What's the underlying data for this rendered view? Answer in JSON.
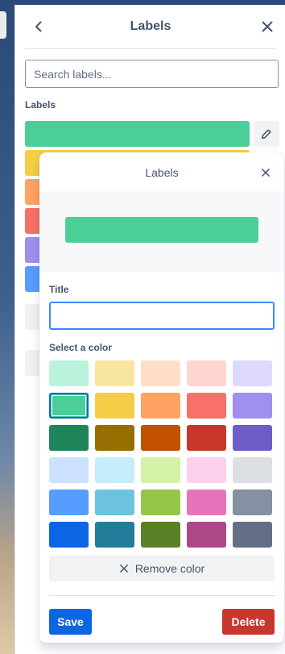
{
  "panel": {
    "title": "Labels",
    "search_placeholder": "Search labels...",
    "labels_heading": "Labels",
    "labels": [
      {
        "color": "#4bce97"
      },
      {
        "color": "#f5cd47"
      },
      {
        "color": "#fea362"
      },
      {
        "color": "#f87168"
      },
      {
        "color": "#9f8fef"
      },
      {
        "color": "#579dff"
      }
    ]
  },
  "popover": {
    "title": "Labels",
    "preview_color": "#4bce97",
    "title_field_label": "Title",
    "title_value": "",
    "color_field_label": "Select a color",
    "remove_color_label": "Remove color",
    "save_label": "Save",
    "delete_label": "Delete",
    "selected_color": "#4bce97",
    "palette": [
      "#baf3db",
      "#f8e6a0",
      "#fedec8",
      "#ffd5d2",
      "#dfd8fd",
      "#4bce97",
      "#f5cd47",
      "#fea362",
      "#f87168",
      "#9f8fef",
      "#1f845a",
      "#946f00",
      "#c25100",
      "#c9372c",
      "#6e5dc6",
      "#cce0ff",
      "#c6edfb",
      "#d3f1a7",
      "#fdd0ec",
      "#dcdfe4",
      "#579dff",
      "#6cc3e0",
      "#94c748",
      "#e774bb",
      "#8590a2",
      "#0c66e4",
      "#227d9b",
      "#5b7f24",
      "#ae4787",
      "#626f86"
    ]
  },
  "colors": {
    "accent": "#0c66e4",
    "danger": "#c9372c"
  },
  "icons": {
    "back": "chevron-left-icon",
    "close": "close-icon",
    "edit": "pencil-icon",
    "remove": "x-icon"
  }
}
